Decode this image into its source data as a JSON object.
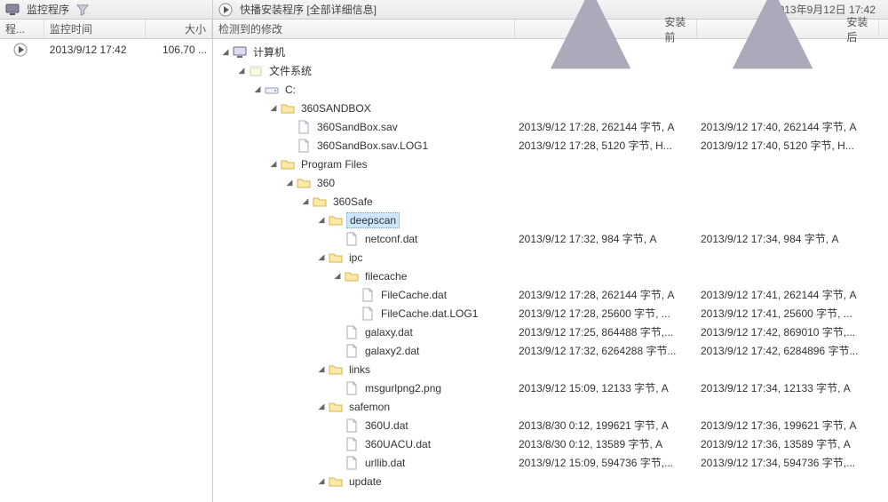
{
  "leftPanel": {
    "title": "监控程序",
    "cols": {
      "c1": "程...",
      "c2": "监控时间",
      "c3": "大小"
    },
    "row": {
      "time": "2013/9/12 17:42",
      "size": "106.70 ..."
    }
  },
  "rightPanel": {
    "title": "快播安装程序 [全部详细信息]",
    "headerTime": "2013年9月12日 17:42",
    "cols": {
      "c1": "检测到的修改",
      "c2": "安装前",
      "c3": "安装后"
    }
  },
  "tree": [
    {
      "d": 0,
      "exp": "open",
      "ico": "computer",
      "label": "计算机"
    },
    {
      "d": 1,
      "exp": "open",
      "ico": "fs",
      "label": "文件系统"
    },
    {
      "d": 2,
      "exp": "open",
      "ico": "drive",
      "label": "C:"
    },
    {
      "d": 3,
      "exp": "open",
      "ico": "folder",
      "label": "360SANDBOX"
    },
    {
      "d": 4,
      "exp": "none",
      "ico": "file",
      "label": "360SandBox.sav",
      "b": "2013/9/12 17:28, 262144 字节, A",
      "a": "2013/9/12 17:40, 262144 字节, A"
    },
    {
      "d": 4,
      "exp": "none",
      "ico": "file",
      "label": "360SandBox.sav.LOG1",
      "b": "2013/9/12 17:28, 5120 字节, H...",
      "a": "2013/9/12 17:40, 5120 字节, H..."
    },
    {
      "d": 3,
      "exp": "open",
      "ico": "folder",
      "label": "Program Files"
    },
    {
      "d": 4,
      "exp": "open",
      "ico": "folder",
      "label": "360"
    },
    {
      "d": 5,
      "exp": "open",
      "ico": "folder",
      "label": "360Safe"
    },
    {
      "d": 6,
      "exp": "open",
      "ico": "folder",
      "label": "deepscan",
      "sel": true
    },
    {
      "d": 7,
      "exp": "none",
      "ico": "file",
      "label": "netconf.dat",
      "b": "2013/9/12 17:32, 984 字节, A",
      "a": "2013/9/12 17:34, 984 字节, A"
    },
    {
      "d": 6,
      "exp": "open",
      "ico": "folder",
      "label": "ipc"
    },
    {
      "d": 7,
      "exp": "open",
      "ico": "folder",
      "label": "filecache"
    },
    {
      "d": 8,
      "exp": "none",
      "ico": "file",
      "label": "FileCache.dat",
      "b": "2013/9/12 17:28, 262144 字节, A",
      "a": "2013/9/12 17:41, 262144 字节, A"
    },
    {
      "d": 8,
      "exp": "none",
      "ico": "file",
      "label": "FileCache.dat.LOG1",
      "b": "2013/9/12 17:28, 25600 字节, ...",
      "a": "2013/9/12 17:41, 25600 字节, ..."
    },
    {
      "d": 7,
      "exp": "none",
      "ico": "file",
      "label": "galaxy.dat",
      "b": "2013/9/12 17:25, 864488 字节,...",
      "a": "2013/9/12 17:42, 869010 字节,..."
    },
    {
      "d": 7,
      "exp": "none",
      "ico": "file",
      "label": "galaxy2.dat",
      "b": "2013/9/12 17:32, 6264288 字节...",
      "a": "2013/9/12 17:42, 6284896 字节..."
    },
    {
      "d": 6,
      "exp": "open",
      "ico": "folder",
      "label": "links"
    },
    {
      "d": 7,
      "exp": "none",
      "ico": "file",
      "label": "msgurlpng2.png",
      "b": "2013/9/12 15:09, 12133 字节, A",
      "a": "2013/9/12 17:34, 12133 字节, A"
    },
    {
      "d": 6,
      "exp": "open",
      "ico": "folder",
      "label": "safemon"
    },
    {
      "d": 7,
      "exp": "none",
      "ico": "file",
      "label": "360U.dat",
      "b": "2013/8/30 0:12, 199621 字节, A",
      "a": "2013/9/12 17:36, 199621 字节, A"
    },
    {
      "d": 7,
      "exp": "none",
      "ico": "file",
      "label": "360UACU.dat",
      "b": "2013/8/30 0:12, 13589 字节, A",
      "a": "2013/9/12 17:36, 13589 字节, A"
    },
    {
      "d": 7,
      "exp": "none",
      "ico": "file",
      "label": "urllib.dat",
      "b": "2013/9/12 15:09, 594736 字节,...",
      "a": "2013/9/12 17:34, 594736 字节,..."
    },
    {
      "d": 6,
      "exp": "open",
      "ico": "folder",
      "label": "update"
    }
  ]
}
